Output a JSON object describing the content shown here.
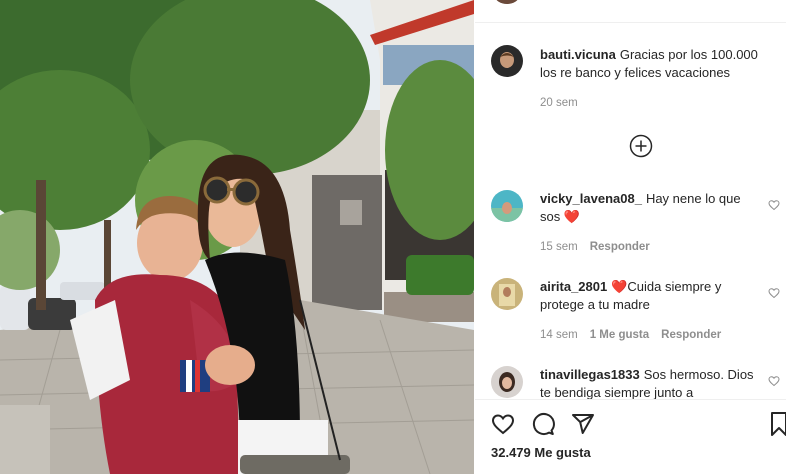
{
  "post": {
    "photo_alt": "",
    "likes": "32.479 Me gusta",
    "date_cut": ""
  },
  "caption": {
    "username": "bauti.vicuna",
    "text": "Gracias por los 100.000 los re banco y felices vacaciones",
    "time": "20 sem"
  },
  "load_more_icon": "plus-circle-icon",
  "comments": [
    {
      "username": "vicky_lavena08_",
      "text": "Hay nene lo que sos",
      "emoji": "❤️",
      "time": "15 sem",
      "likes": "",
      "reply": "Responder"
    },
    {
      "username": "airita_2801",
      "emoji": "❤️",
      "text": "Cuida siempre y protege a tu madre",
      "time": "14 sem",
      "likes": "1 Me gusta",
      "reply": "Responder"
    },
    {
      "username": "tinavillegas1833",
      "text": "Sos hermoso. Dios te bendiga siempre junto a",
      "time": "",
      "likes": "",
      "reply": ""
    }
  ],
  "actions": {
    "like": "heart-icon",
    "comment": "comment-icon",
    "share": "share-icon",
    "save": "bookmark-icon"
  },
  "colors": {
    "heart": "#ed4956",
    "text": "#262626",
    "muted": "#8e8e8e",
    "border": "#efefef"
  }
}
